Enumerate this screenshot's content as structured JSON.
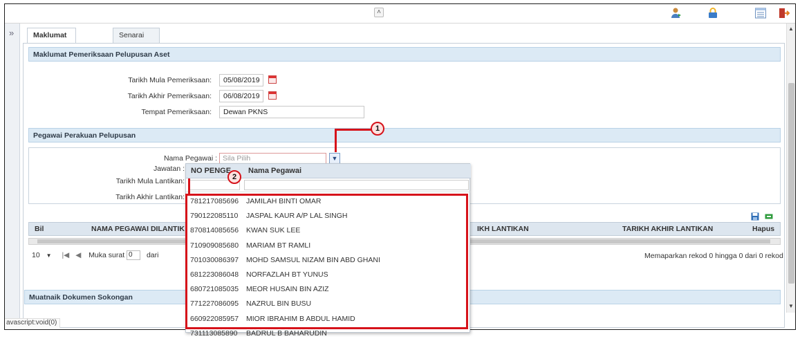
{
  "toolbar": {
    "collapse_glyph": "»",
    "up_glyph": "˄",
    "icons": [
      "user-swap-icon",
      "lock-icon",
      "list-window-icon",
      "logout-door-icon"
    ]
  },
  "tabs": [
    {
      "label": "Maklumat Pelupusan",
      "active": true
    },
    {
      "label": "Senarai Aset Pelupusan",
      "active": false
    }
  ],
  "sections": {
    "pemeriksaan": {
      "title": "Maklumat Pemeriksaan Pelupusan Aset",
      "tarikh_mula_label": "Tarikh Mula Pemeriksaan:",
      "tarikh_mula_value": "05/08/2019",
      "tarikh_akhir_label": "Tarikh Akhir Pemeriksaan:",
      "tarikh_akhir_value": "06/08/2019",
      "tempat_label": "Tempat Pemeriksaan:",
      "tempat_value": "Dewan PKNS"
    },
    "pegawai": {
      "title": "Pegawai Perakuan Pelupusan",
      "nama_label": "Nama Pegawai :",
      "nama_placeholder": "Sila Pilih",
      "jawatan_label": "Jawatan :",
      "tarikh_mula_label": "Tarikh Mula Lantikan:",
      "tarikh_akhir_label": "Tarikh Akhir Lantikan:"
    },
    "muatnaik": {
      "title": "Muatnaik Dokumen Sokongan"
    }
  },
  "grid": {
    "columns": [
      "Bil",
      "NAMA PEGAWAI DILANTIK",
      "TARIKH LANTIKAN",
      "TARIKH AKHIR LANTIKAN",
      "Hapus"
    ],
    "col_partial": "IKH LANTIKAN",
    "col_nama_visible": "NAMA PEGAWAI DILANTIK",
    "page_size": "10",
    "page_label": "Muka surat",
    "page_value": "0",
    "page_of": "dari",
    "record_info": "Memaparkan rekod 0 hingga 0 dari 0 rekod"
  },
  "dropdown": {
    "col_no": "NO PENGE",
    "col_nama": "Nama Pegawai",
    "rows": [
      {
        "no": "781217085696",
        "nama": "JAMILAH BINTI OMAR"
      },
      {
        "no": "790122085110",
        "nama": "JASPAL KAUR A/P LAL SINGH"
      },
      {
        "no": "870814085656",
        "nama": "KWAN SUK LEE"
      },
      {
        "no": "710909085680",
        "nama": "MARIAM BT RAMLI"
      },
      {
        "no": "701030086397",
        "nama": "MOHD SAMSUL NIZAM BIN ABD GHANI"
      },
      {
        "no": "681223086048",
        "nama": "NORFAZLAH BT YUNUS"
      },
      {
        "no": "680721085035",
        "nama": "MEOR HUSAIN BIN AZIZ"
      },
      {
        "no": "771227086095",
        "nama": "NAZRUL BIN BUSU"
      },
      {
        "no": "660922085957",
        "nama": "MIOR IBRAHIM B ABDUL HAMID"
      },
      {
        "no": "731113085890",
        "nama": "BADRUL B BAHARUDIN"
      }
    ]
  },
  "callouts": {
    "one": "1",
    "two": "2"
  },
  "status_bar": "avascript:void(0)",
  "colors": {
    "accent_red": "#d6121a",
    "header_blue": "#dceaf5"
  }
}
